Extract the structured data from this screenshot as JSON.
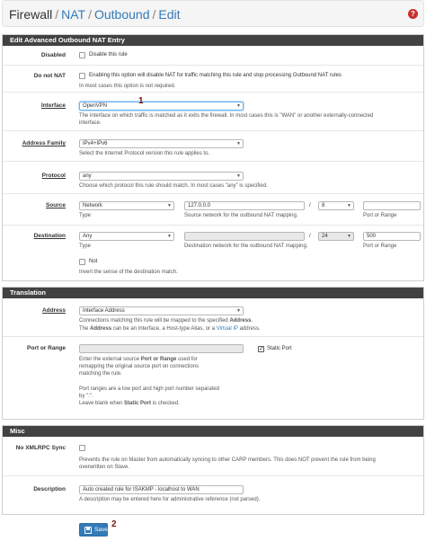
{
  "breadcrumb": {
    "root": "Firewall",
    "nat": "NAT",
    "outbound": "Outbound",
    "edit": "Edit",
    "separator": "/"
  },
  "sections": {
    "edit": "Edit Advanced Outbound NAT Entry",
    "translation": "Translation",
    "misc": "Misc"
  },
  "disabled": {
    "label": "Disabled",
    "checkbox": "Disable this rule"
  },
  "donat": {
    "label": "Do not NAT",
    "checkbox": "Enabling this option will disable NAT for traffic matching this rule and stop processing Outbound NAT rules",
    "help": "In most cases this option is not required."
  },
  "interface": {
    "label": "Interface",
    "value": "OpenVPN",
    "help1": "The interface on which traffic is matched as it exits the firewall. In most cases this is \"WAN\" or another externally-connected",
    "help2": "interface."
  },
  "family": {
    "label": "Address Family",
    "value": "IPv4+IPv6",
    "help": "Select the Internet Protocol version this rule applies to."
  },
  "protocol": {
    "label": "Protocol",
    "value": "any",
    "help": "Choose which protocol this rule should match. In most cases \"any\" is specified."
  },
  "source": {
    "label": "Source",
    "type": "Network",
    "address": "127.0.0.0",
    "slash": "/",
    "mask": "8",
    "port": "",
    "type_help": "Type",
    "addr_help": "Source network for the outbound NAT mapping.",
    "port_help": "Port or Range"
  },
  "destination": {
    "label": "Destination",
    "type": "Any",
    "address": "",
    "slash": "/",
    "mask": "24",
    "port": "500",
    "type_help": "Type",
    "addr_help": "Destination network for the outbound NAT mapping.",
    "port_help": "Port or Range",
    "not_label": "Not",
    "not_help": "Invert the sense of the destination match."
  },
  "address": {
    "label": "Address",
    "value": "Interface Address",
    "help1": "Connections matching this rule will be mapped to the specified",
    "help1_bold": "Address",
    "help2_the": "The",
    "help2_bold": "Address",
    "help2_mid": "can be an Interface, a Host-type Alias, or a",
    "help2_link": "Virtual IP",
    "help2_end": "address."
  },
  "portrange": {
    "label": "Port or Range",
    "value": "",
    "static_port": "Static Port",
    "help1a": "Enter the external source",
    "help1b": "Port or Range",
    "help1c": "used for",
    "help2": "remapping the original source port on connections",
    "help3": "matching the rule.",
    "help4": "Port ranges are a low port and high port number separated",
    "help5": "by \":\".",
    "help6a": "Leave blank when",
    "help6b": "Static Port",
    "help6c": "is checked."
  },
  "noxmlrpc": {
    "label": "No XMLRPC Sync",
    "help1": "Prevents the rule on Master from automatically syncing to other CARP members. This does NOT prevent the rule from being",
    "help2": "overwritten on Slave."
  },
  "description": {
    "label": "Description",
    "value": "Auto created rule for ISAKMP - localhost to WAN",
    "help": "A description may be entered here for administrative reference (not parsed)."
  },
  "save_label": "Save",
  "annotations": {
    "one": "1",
    "two": "2"
  },
  "colors": {
    "accent": "#337ab7",
    "section_header": "#424242",
    "help_icon": "#c9302c"
  }
}
